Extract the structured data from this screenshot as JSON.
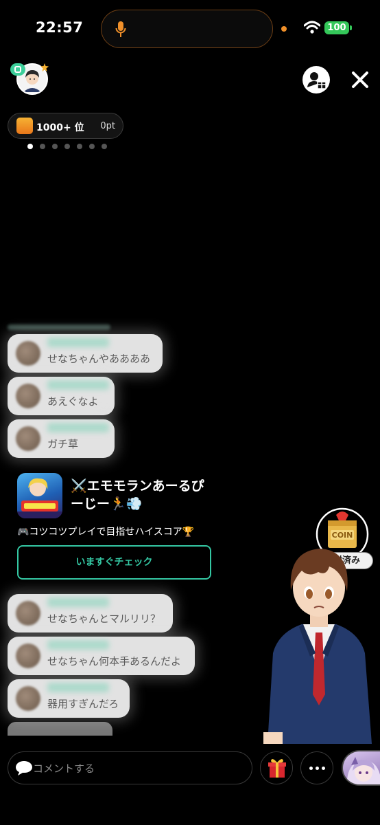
{
  "status_bar": {
    "time": "22:57",
    "battery": "100",
    "icons": [
      "mic-icon",
      "wifi-icon",
      "battery-icon"
    ]
  },
  "header": {
    "avatar_badge": "",
    "rank_label": "1000+ 位",
    "points": "0pt",
    "page_dots_count": 7,
    "active_dot": 0
  },
  "comments_top": [
    {
      "text": "せなちゃんやああああ"
    },
    {
      "text": "あえぐなよ"
    },
    {
      "text": "ガチ草"
    }
  ],
  "promo": {
    "title": "⚔️エモモランあーるぴーじー🏃💨",
    "description": "🎮コツコツプレイで目指せハイスコア🏆",
    "button_label": "いますぐチェック"
  },
  "comments_bottom": [
    {
      "text": "せなちゃんとマルリリ？"
    },
    {
      "text": "せなちゃん何本手あるんだよ"
    },
    {
      "text": "器用すぎんだろ"
    }
  ],
  "coin_box": {
    "coin_text": "COIN",
    "label": "開封済み"
  },
  "bottom_bar": {
    "comment_placeholder": "コメントする"
  },
  "colors": {
    "accent": "#34c7a3",
    "battery": "#34c759",
    "island_border": "#6e3f15"
  }
}
